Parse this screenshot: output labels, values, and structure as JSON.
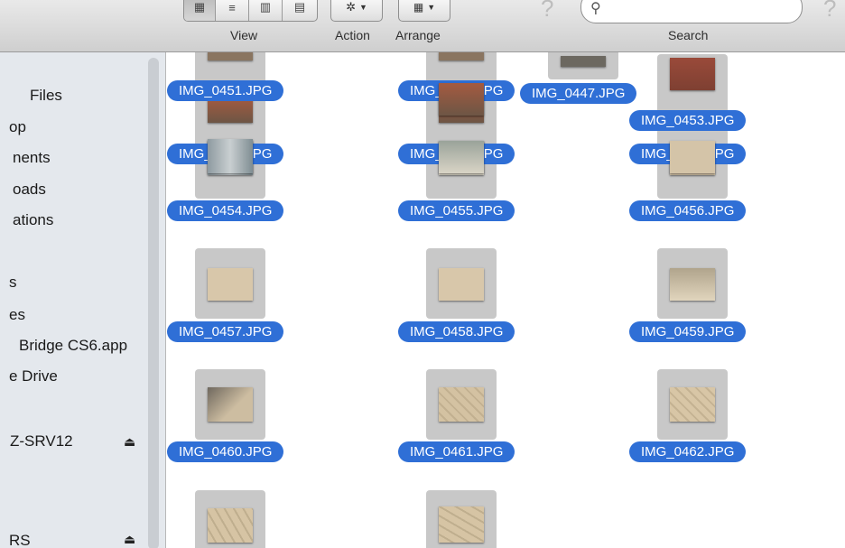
{
  "toolbar": {
    "view_label": "View",
    "action_label": "Action",
    "arrange_label": "Arrange",
    "search_label": "Search",
    "help_glyph": "?",
    "search_placeholder": ""
  },
  "sidebar": {
    "items": [
      {
        "label": "Files"
      },
      {
        "label": "op"
      },
      {
        "label": "nents"
      },
      {
        "label": "oads"
      },
      {
        "label": "ations"
      },
      {
        "label": "s"
      },
      {
        "label": "es"
      },
      {
        "label": "Bridge CS6.app"
      },
      {
        "label": "e Drive"
      },
      {
        "label": "Z-SRV12"
      },
      {
        "label": "RS"
      }
    ],
    "eject_glyph": "⏏"
  },
  "files": [
    {
      "name": "IMG_0451.JPG"
    },
    {
      "name": "IMG_0452.JPG"
    },
    {
      "name": "IMG_0447.JPG"
    },
    {
      "name": "IMG_0453.JPG"
    },
    {
      "name": "IMG_0448.JPG"
    },
    {
      "name": "IMG_0449.JPG"
    },
    {
      "name": "IMG_0450.JPG"
    },
    {
      "name": "IMG_0454.JPG"
    },
    {
      "name": "IMG_0455.JPG"
    },
    {
      "name": "IMG_0456.JPG"
    },
    {
      "name": "IMG_0457.JPG"
    },
    {
      "name": "IMG_0458.JPG"
    },
    {
      "name": "IMG_0459.JPG"
    },
    {
      "name": "IMG_0460.JPG"
    },
    {
      "name": "IMG_0461.JPG"
    },
    {
      "name": "IMG_0462.JPG"
    }
  ],
  "colors": {
    "selection": "#2f6fd6",
    "sidebar_bg": "#e4e8ed"
  }
}
